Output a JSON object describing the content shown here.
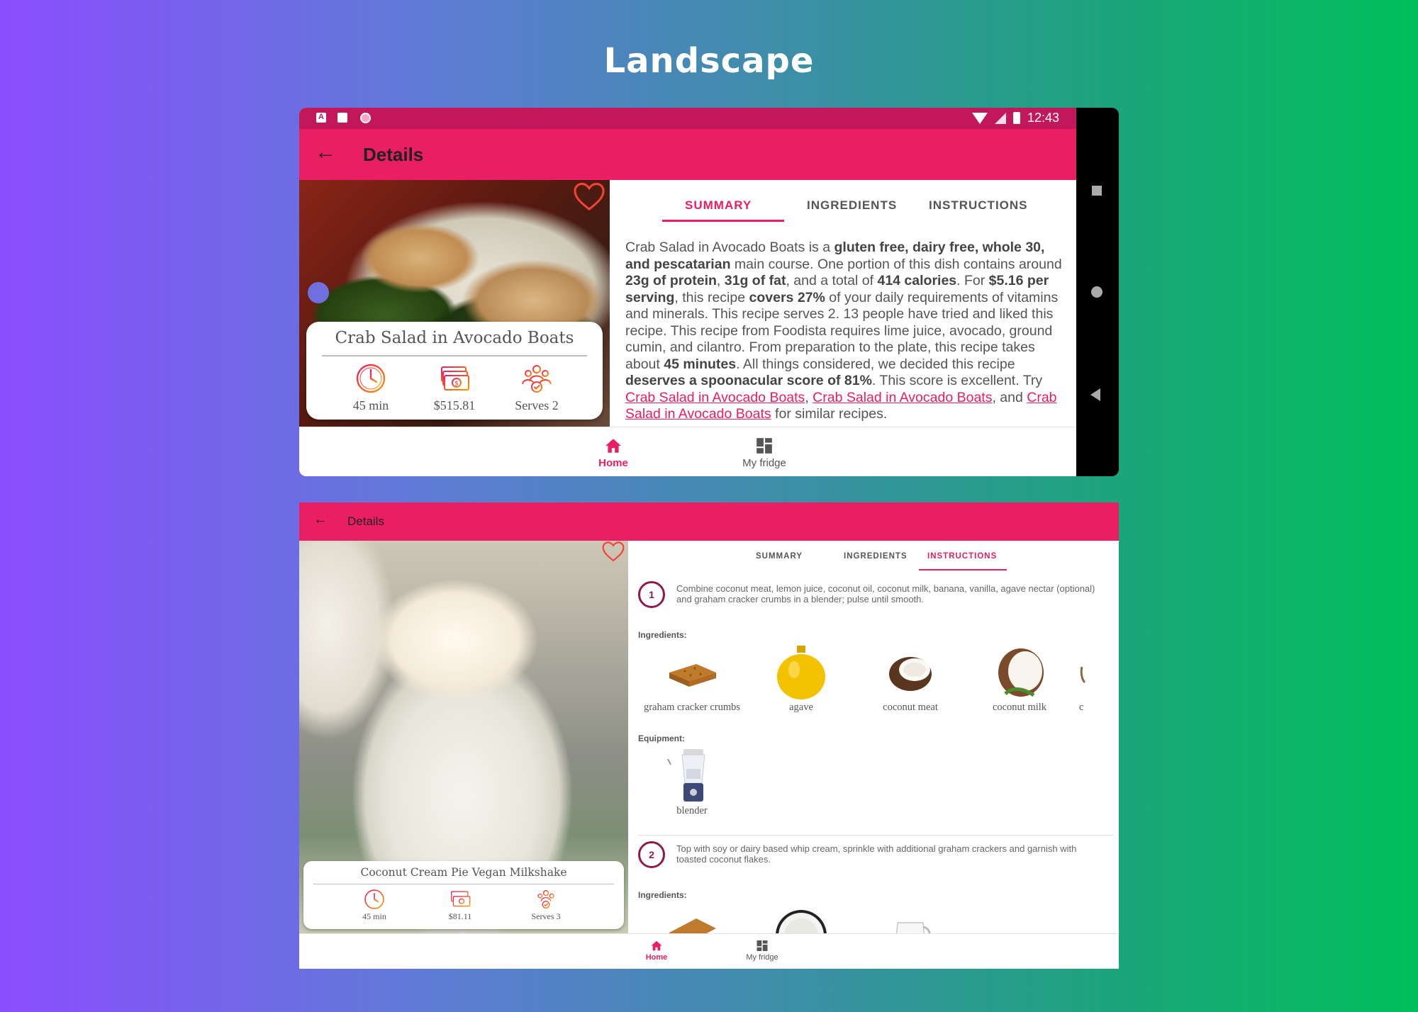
{
  "page": {
    "heading": "Landscape"
  },
  "colors": {
    "primary": "#e91e63",
    "primary_dark": "#c2185b",
    "step_ring": "#8e1a4a"
  },
  "phone1": {
    "status_bar": {
      "time": "12:43"
    },
    "toolbar": {
      "title": "Details",
      "back_icon": "arrow-left-icon"
    },
    "recipe": {
      "title": "Crab Salad in Avocado Boats",
      "time": "45 min",
      "price": "$515.81",
      "serves": "Serves 2"
    },
    "tabs": [
      {
        "label": "SUMMARY",
        "active": true
      },
      {
        "label": "INGREDIENTS",
        "active": false
      },
      {
        "label": "INSTRUCTIONS",
        "active": false
      }
    ],
    "summary": {
      "t1": "Crab Salad in Avocado Boats is a ",
      "b1": "gluten free, dairy free, whole 30, and pescatarian",
      "t2": " main course. One portion of this dish contains around ",
      "b2": "23g of protein",
      "t3": ", ",
      "b3": "31g of fat",
      "t4": ", and a total of ",
      "b4": "414 calories",
      "t5": ". For ",
      "b5": "$5.16 per serving",
      "t6": ", this recipe ",
      "b6": "covers 27%",
      "t7": " of your daily requirements of vitamins and minerals. This recipe serves 2. 13 people have tried and liked this recipe. This recipe from Foodista requires lime juice, avocado, ground cumin, and cilantro. From preparation to the plate, this recipe takes about ",
      "b7": "45 minutes",
      "t8": ". All things considered, we decided this recipe ",
      "b8": "deserves a spoonacular score of 81%",
      "t9": ". This score is excellent. Try ",
      "link1": "Crab Salad in Avocado Boats",
      "t10": ", ",
      "link2": "Crab Salad in Avocado Boats",
      "t11": ", and ",
      "link3": "Crab Salad in Avocado Boats",
      "t12": " for similar recipes."
    },
    "bottom_nav": [
      {
        "label": "Home",
        "icon": "home-icon",
        "active": true
      },
      {
        "label": "My fridge",
        "icon": "dashboard-icon",
        "active": false
      }
    ]
  },
  "phone2": {
    "toolbar": {
      "title": "Details",
      "back_icon": "arrow-left-icon"
    },
    "recipe": {
      "title": "Coconut Cream Pie Vegan Milkshake",
      "time": "45 min",
      "price": "$81.11",
      "serves": "Serves 3"
    },
    "tabs": [
      {
        "label": "SUMMARY",
        "active": false
      },
      {
        "label": "INGREDIENTS",
        "active": false
      },
      {
        "label": "INSTRUCTIONS",
        "active": true
      }
    ],
    "steps": [
      {
        "number": "1",
        "text": "Combine coconut meat, lemon juice, coconut oil, coconut milk, banana, vanilla, agave nectar (optional) and graham cracker crumbs in a blender; pulse until smooth.",
        "ingredients_label": "Ingredients:",
        "ingredients": [
          "graham cracker crumbs",
          "agave",
          "coconut meat",
          "coconut milk",
          "c"
        ],
        "equipment_label": "Equipment:",
        "equipment": [
          "blender"
        ]
      },
      {
        "number": "2",
        "text": "Top with soy or dairy based whip cream, sprinkle with additional graham crackers and garnish with toasted coconut flakes.",
        "ingredients_label": "Ingredients:"
      }
    ],
    "bottom_nav": [
      {
        "label": "Home",
        "icon": "home-icon",
        "active": true
      },
      {
        "label": "My fridge",
        "icon": "dashboard-icon",
        "active": false
      }
    ]
  }
}
